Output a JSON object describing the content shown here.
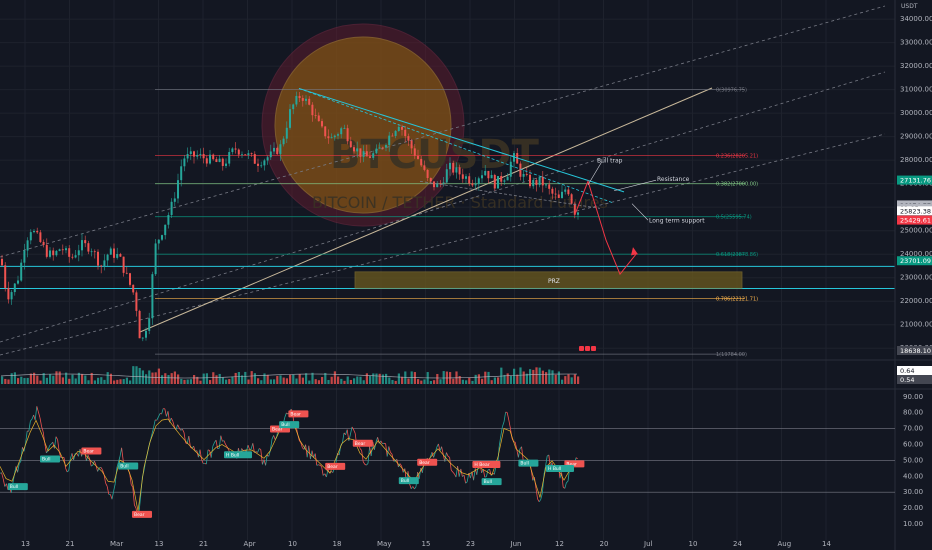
{
  "chart_data": {
    "type": "candlestick",
    "symbol": "BTCUSDT",
    "ticker_watermark": "BTCUSDT",
    "watermark_sub": "BITCOIN / TETHER · Standard Futures",
    "currency": "USDT",
    "price_axis": {
      "ticks": [
        34000,
        33000,
        32000,
        31000,
        30000,
        29000,
        28000,
        27000,
        26000,
        25000,
        24000,
        23000,
        22000,
        21000,
        20000
      ],
      "ylim": [
        19500,
        34600
      ]
    },
    "time_axis": {
      "labels": [
        "13",
        "21",
        "Mar",
        "13",
        "21",
        "Apr",
        "10",
        "18",
        "May",
        "15",
        "23",
        "Jun",
        "12",
        "20",
        "Jul",
        "10",
        "24",
        "Aug",
        "14"
      ]
    },
    "fib_levels": [
      {
        "ratio": "0",
        "value": 31000,
        "label": "0(30976.75)",
        "color": "#787b86"
      },
      {
        "ratio": "0.236",
        "value": 28205,
        "label": "0.236(28205.21)",
        "color": "#f23645"
      },
      {
        "ratio": "0.382",
        "value": 27000,
        "label": "0.382(27000.00)",
        "color": "#81c784"
      },
      {
        "ratio": "0.5",
        "value": 25595,
        "label": "0.5(25595.74)",
        "color": "#089981"
      },
      {
        "ratio": "0.618",
        "value": 24000,
        "label": "0.618(23878.86)",
        "color": "#089981"
      },
      {
        "ratio": "0.786",
        "value": 22120,
        "label": "0.786(22121.71)",
        "color": "#ffb74d"
      },
      {
        "ratio": "1",
        "value": 19750,
        "label": "1(19784.00)",
        "color": "#787b86"
      }
    ],
    "prz": {
      "label": "PRZ",
      "top": 23250,
      "bottom": 22550
    },
    "annotations": [
      "Bull trap",
      "Resistance",
      "Long term support"
    ],
    "price_labels": [
      {
        "text": "27131.76",
        "value": 27131.76,
        "bg": "#089981",
        "fg": "#ffffff"
      },
      {
        "text": "26074.77",
        "value": 26074.77,
        "bg": "#b2b5be",
        "fg": "#131722"
      },
      {
        "text": "01:05",
        "value": 25950,
        "bg": "#b2b5be",
        "fg": "#131722"
      },
      {
        "text": "25823.38",
        "value": 25823.38,
        "bg": "#ffffff",
        "fg": "#131722"
      },
      {
        "text": "25429.61",
        "value": 25429.61,
        "bg": "#f23645",
        "fg": "#ffffff"
      },
      {
        "text": "23701.09",
        "value": 23701.09,
        "bg": "#089981",
        "fg": "#ffffff"
      },
      {
        "text": "18638.10",
        "value": 18638.1,
        "bg": "#434651",
        "fg": "#ffffff"
      }
    ],
    "volume_labels": [
      "0.64",
      "0.54"
    ],
    "rsi_axis": {
      "ticks": [
        90,
        80,
        70,
        60,
        50,
        40,
        30,
        20,
        10
      ],
      "ylim": [
        5,
        93
      ]
    },
    "rsi_levels": [
      70,
      50,
      30
    ],
    "rsi_markers": {
      "bear": [
        [
          19,
          "Bear"
        ],
        [
          30,
          "Bear"
        ],
        [
          60,
          "Bear"
        ],
        [
          64,
          "Bear"
        ],
        [
          72,
          "Bear"
        ],
        [
          78,
          "Bear"
        ],
        [
          92,
          "Bear"
        ],
        [
          104,
          "H Bear"
        ],
        [
          124,
          "Bear"
        ]
      ],
      "bull": [
        [
          3,
          "Bull"
        ],
        [
          10,
          "Bull"
        ],
        [
          27,
          "Bull"
        ],
        [
          50,
          "H Bull"
        ],
        [
          62,
          "Bull"
        ],
        [
          88,
          "Bull"
        ],
        [
          106,
          "Bull"
        ],
        [
          114,
          "Bull"
        ],
        [
          120,
          "H Bull"
        ]
      ]
    },
    "notes": [
      "Candles from mid-February to June 12; two fibonacci price levels and trend channels"
    ]
  }
}
